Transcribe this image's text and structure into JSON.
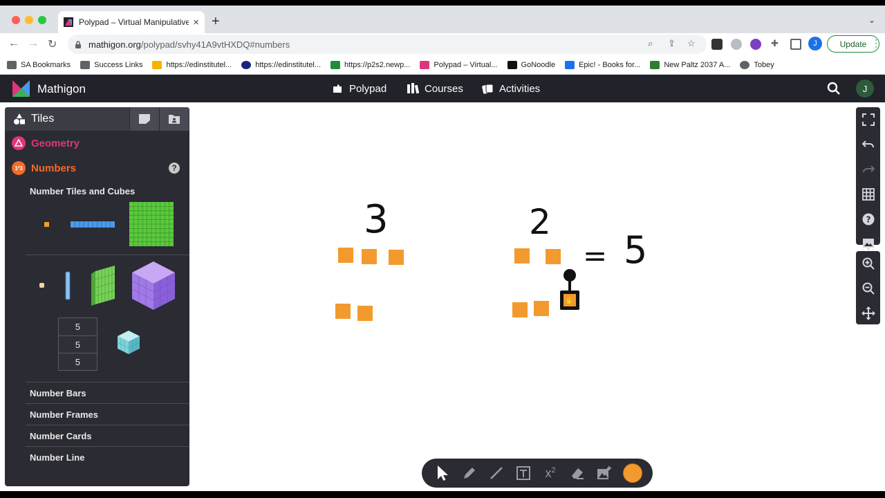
{
  "browser": {
    "tab_title": "Polypad – Virtual Manipulatives",
    "url_host": "mathigon.org",
    "url_path": "/polypad/svhy41A9vtHXDQ#numbers",
    "update_label": "Update",
    "profile_initial": "J",
    "bookmarks": [
      {
        "label": "SA Bookmarks",
        "icon": "folder-icon"
      },
      {
        "label": "Success Links",
        "icon": "folder-icon"
      },
      {
        "label": "https://edinstitutel...",
        "icon": "sa-icon"
      },
      {
        "label": "https://edinstitutel...",
        "icon": "ring-icon"
      },
      {
        "label": "https://p2s2.newp...",
        "icon": "signpost-icon"
      },
      {
        "label": "Polypad – Virtual...",
        "icon": "polypad-icon"
      },
      {
        "label": "GoNoodle",
        "icon": "gonoodle-icon"
      },
      {
        "label": "Epic! - Books for...",
        "icon": "epic-icon"
      },
      {
        "label": "New Paltz 2037 A...",
        "icon": "shield-icon"
      },
      {
        "label": "Tobey",
        "icon": "circle-icon"
      }
    ]
  },
  "header": {
    "brand": "Mathigon",
    "nav": [
      {
        "label": "Polypad",
        "icon": "polypad-nav-icon"
      },
      {
        "label": "Courses",
        "icon": "courses-icon"
      },
      {
        "label": "Activities",
        "icon": "activities-icon"
      }
    ],
    "avatar_initial": "J"
  },
  "sidebar": {
    "title": "Tiles",
    "categories": {
      "geometry": "Geometry",
      "numbers": "Numbers"
    },
    "help": "?",
    "section_title": "Number Tiles and Cubes",
    "stack_values": [
      "5",
      "5",
      "5"
    ],
    "items": [
      "Number Bars",
      "Number Frames",
      "Number Cards",
      "Number Line"
    ],
    "accent_geometry": "#e0357c",
    "accent_numbers": "#f46b29"
  },
  "canvas": {
    "tile_color": "#f39a2e",
    "handwriting": {
      "first": "3",
      "second": "2",
      "equals": "=",
      "result": "5"
    }
  },
  "tools": {
    "superscript": "2",
    "selected_color": "#f39a2e"
  }
}
